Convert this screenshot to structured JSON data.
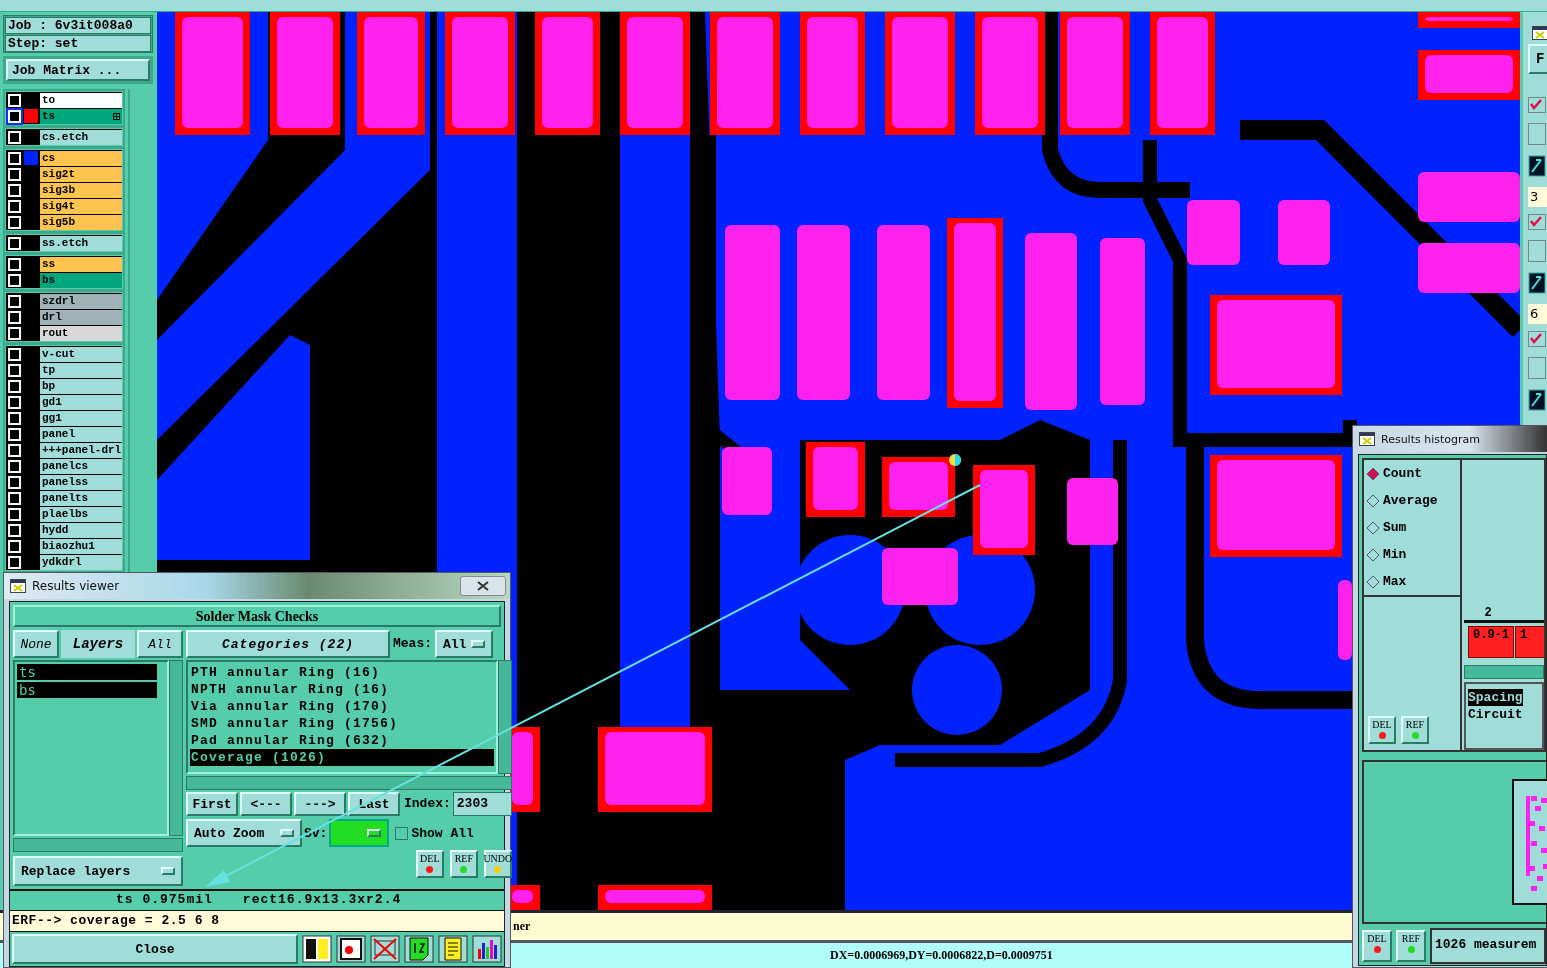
{
  "job_panel": {
    "job": "Job : 6v3it008a0",
    "step": "Step: set",
    "matrix_button": "Job Matrix ..."
  },
  "layer_groups": [
    {
      "layers": [
        {
          "name": "to",
          "kind": "silk_screen",
          "selected": false
        },
        {
          "name": "ts",
          "kind": "solder_mask",
          "selected": true,
          "color": "#ff0000"
        }
      ]
    },
    {
      "layers": [
        {
          "name": "cs.etch",
          "kind": "document",
          "selected": false
        }
      ]
    },
    {
      "layers": [
        {
          "name": "cs",
          "kind": "signal",
          "selected": false,
          "color": "#0022ff"
        },
        {
          "name": "sig2t",
          "kind": "signal",
          "selected": false
        },
        {
          "name": "sig3b",
          "kind": "signal",
          "selected": false
        },
        {
          "name": "sig4t",
          "kind": "signal",
          "selected": false
        },
        {
          "name": "sig5b",
          "kind": "signal",
          "selected": false
        }
      ]
    },
    {
      "layers": [
        {
          "name": "ss.etch",
          "kind": "document",
          "selected": false
        }
      ]
    },
    {
      "layers": [
        {
          "name": "ss",
          "kind": "signal",
          "selected": false
        },
        {
          "name": "bs",
          "kind": "solder_mask",
          "selected": false
        }
      ]
    },
    {
      "layers": [
        {
          "name": "szdrl",
          "kind": "drill",
          "selected": false
        },
        {
          "name": "drl",
          "kind": "drill",
          "selected": false
        },
        {
          "name": "rout",
          "kind": "rout",
          "selected": false
        }
      ]
    },
    {
      "layers": [
        {
          "name": "v-cut",
          "kind": "document",
          "selected": false
        },
        {
          "name": "tp",
          "kind": "document",
          "selected": false
        },
        {
          "name": "bp",
          "kind": "document",
          "selected": false
        },
        {
          "name": "gd1",
          "kind": "document",
          "selected": false
        },
        {
          "name": "gg1",
          "kind": "document",
          "selected": false
        },
        {
          "name": "panel",
          "kind": "document",
          "selected": false
        },
        {
          "name": "+++panel-drl",
          "kind": "document",
          "selected": false
        },
        {
          "name": "panelcs",
          "kind": "document",
          "selected": false
        },
        {
          "name": "panelss",
          "kind": "document",
          "selected": false
        },
        {
          "name": "panelts",
          "kind": "document",
          "selected": false
        },
        {
          "name": "plaelbs",
          "kind": "document",
          "selected": false
        },
        {
          "name": "hydd",
          "kind": "document",
          "selected": false
        },
        {
          "name": "biaozhu1",
          "kind": "document",
          "selected": false
        },
        {
          "name": "ydkdrl",
          "kind": "document",
          "selected": false
        }
      ]
    }
  ],
  "right_panel": {
    "button": "F",
    "rows": [
      {
        "checked": true,
        "value": "3"
      },
      {
        "checked": true,
        "value": "6"
      },
      {
        "checked": true
      }
    ]
  },
  "results_viewer": {
    "title": "Results viewer",
    "header": "Solder Mask Checks",
    "none_button": "None",
    "layers_label": "Layers",
    "all_button": "All",
    "layers": [
      {
        "name": "ts",
        "selected": true
      },
      {
        "name": "bs",
        "selected": true
      }
    ],
    "replace_mode": "Replace layers",
    "categories_button": "Categories (22)",
    "meas_label": "Meas:",
    "meas_value": "All",
    "categories": [
      {
        "name": "PTH annular Ring (16)",
        "selected": false
      },
      {
        "name": "NPTH annular Ring (16)",
        "selected": false
      },
      {
        "name": "Via annular Ring (170)",
        "selected": false
      },
      {
        "name": "SMD annular Ring (1756)",
        "selected": false
      },
      {
        "name": "Pad annular Ring (632)",
        "selected": false
      },
      {
        "name": "Coverage (1026)",
        "selected": true
      }
    ],
    "nav_buttons": [
      "First",
      "<---",
      "--->",
      "Last"
    ],
    "index_label": "Index:",
    "index_value": "2303",
    "zoom_mode": "Auto Zoom",
    "sv_label": "Sv:",
    "show_all": {
      "label": "Show All",
      "checked": false
    },
    "action_buttons": [
      {
        "label": "DEL",
        "kind": "delete"
      },
      {
        "label": "REF",
        "kind": "reference"
      },
      {
        "label": "UNDO",
        "kind": "undo"
      }
    ],
    "measure_info": [
      "ts 0.975mil",
      "rect16.9x13.3xr2.4"
    ],
    "erf_line": "ERF--> coverage = 2.5 6 8",
    "close_button": "Close"
  },
  "histogram": {
    "title": "Results histogram",
    "modes": [
      {
        "label": "Count",
        "selected": true
      },
      {
        "label": "Average",
        "selected": false
      },
      {
        "label": "Sum",
        "selected": false
      },
      {
        "label": "Min",
        "selected": false
      },
      {
        "label": "Max",
        "selected": false
      }
    ],
    "buttons": [
      {
        "label": "DEL",
        "kind": "delete"
      },
      {
        "label": "REF",
        "kind": "reference"
      }
    ],
    "bins": [
      {
        "label": "0.9-1",
        "count": "2"
      },
      {
        "label": "1"
      }
    ],
    "categories": [
      {
        "name": "Spacing",
        "selected": true
      },
      {
        "name": "Circuit",
        "selected": false
      }
    ],
    "footer_buttons": [
      {
        "label": "DEL",
        "kind": "delete"
      },
      {
        "label": "REF",
        "kind": "reference"
      }
    ],
    "summary": "1026 measurem"
  },
  "status": {
    "message": "ner",
    "coordinates": "DX=0.0006969,DY=0.0006822,D=0.0009751"
  }
}
